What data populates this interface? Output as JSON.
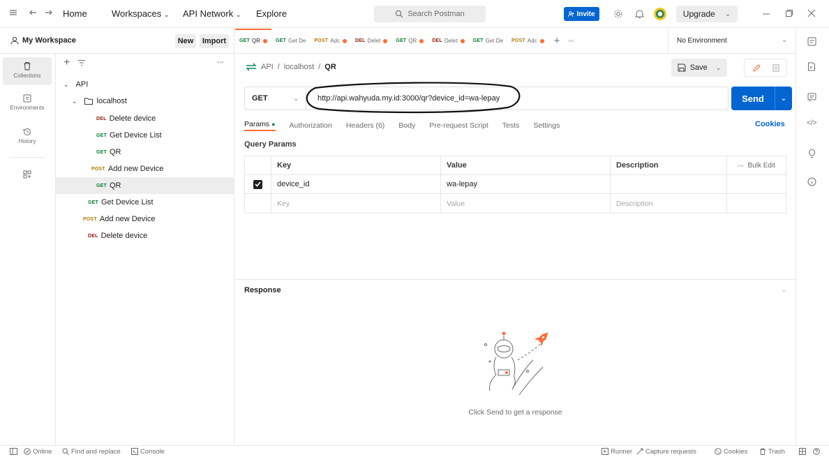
{
  "topbar": {
    "nav": {
      "home": "Home",
      "workspaces": "Workspaces",
      "api_network": "API Network",
      "explore": "Explore"
    },
    "search_placeholder": "Search Postman",
    "invite": "Invite",
    "upgrade": "Upgrade"
  },
  "workspace": {
    "name": "My Workspace",
    "new": "New",
    "import": "Import"
  },
  "rail": [
    {
      "label": "Collections",
      "icon": "trash-can-icon"
    },
    {
      "label": "Environments",
      "icon": "environment-icon"
    },
    {
      "label": "History",
      "icon": "history-icon"
    },
    {
      "label": "",
      "icon": "add-apps-icon"
    }
  ],
  "tree": {
    "collection": "API",
    "folder": "localhost",
    "items": [
      {
        "method": "DEL",
        "name": "Delete device"
      },
      {
        "method": "GET",
        "name": "Get Device List"
      },
      {
        "method": "GET",
        "name": "QR"
      },
      {
        "method": "POST",
        "name": "Add new Device"
      },
      {
        "method": "GET",
        "name": "QR"
      },
      {
        "method": "GET",
        "name": "Get Device List"
      },
      {
        "method": "POST",
        "name": "Add new Device"
      },
      {
        "method": "DEL",
        "name": "Delete device"
      }
    ]
  },
  "tabs": [
    {
      "method": "GET",
      "name": "QR"
    },
    {
      "method": "GET",
      "name": "Get De"
    },
    {
      "method": "POST",
      "name": "Adc"
    },
    {
      "method": "DEL",
      "name": "Delet"
    },
    {
      "method": "GET",
      "name": "QR"
    },
    {
      "method": "DEL",
      "name": "Delet"
    },
    {
      "method": "GET",
      "name": "Get De"
    },
    {
      "method": "POST",
      "name": "Adc"
    }
  ],
  "environment": "No Environment",
  "request": {
    "breadcrumb": {
      "part1": "API",
      "sep": "/",
      "part2": "localhost",
      "current": "QR"
    },
    "save": "Save",
    "method": "GET",
    "url": "http://api.wahyuda.my.id:3000/qr?device_id=wa-lepay",
    "send": "Send",
    "subtabs": {
      "params": "Params",
      "authorization": "Authorization",
      "headers": "Headers (6)",
      "body": "Body",
      "prerequest": "Pre-request Script",
      "tests": "Tests",
      "settings": "Settings"
    },
    "cookies": "Cookies",
    "query_params_title": "Query Params",
    "table": {
      "headers": {
        "key": "Key",
        "value": "Value",
        "description": "Description",
        "bulk_edit": "Bulk Edit"
      },
      "row": {
        "key": "device_id",
        "value": "wa-lepay"
      },
      "placeholder": {
        "key": "Key",
        "value": "Value",
        "description": "Description"
      }
    }
  },
  "response": {
    "title": "Response",
    "empty": "Click Send to get a response"
  },
  "statusbar": {
    "online": "Online",
    "find": "Find and replace",
    "console": "Console",
    "runner": "Runner",
    "capture": "Capture requests",
    "cookies": "Cookies",
    "trash": "Trash"
  },
  "colors": {
    "accent": "#ff6c37",
    "primary": "#0265d2",
    "get": "#007f31",
    "post": "#ad7a03",
    "del": "#8e1a10"
  }
}
